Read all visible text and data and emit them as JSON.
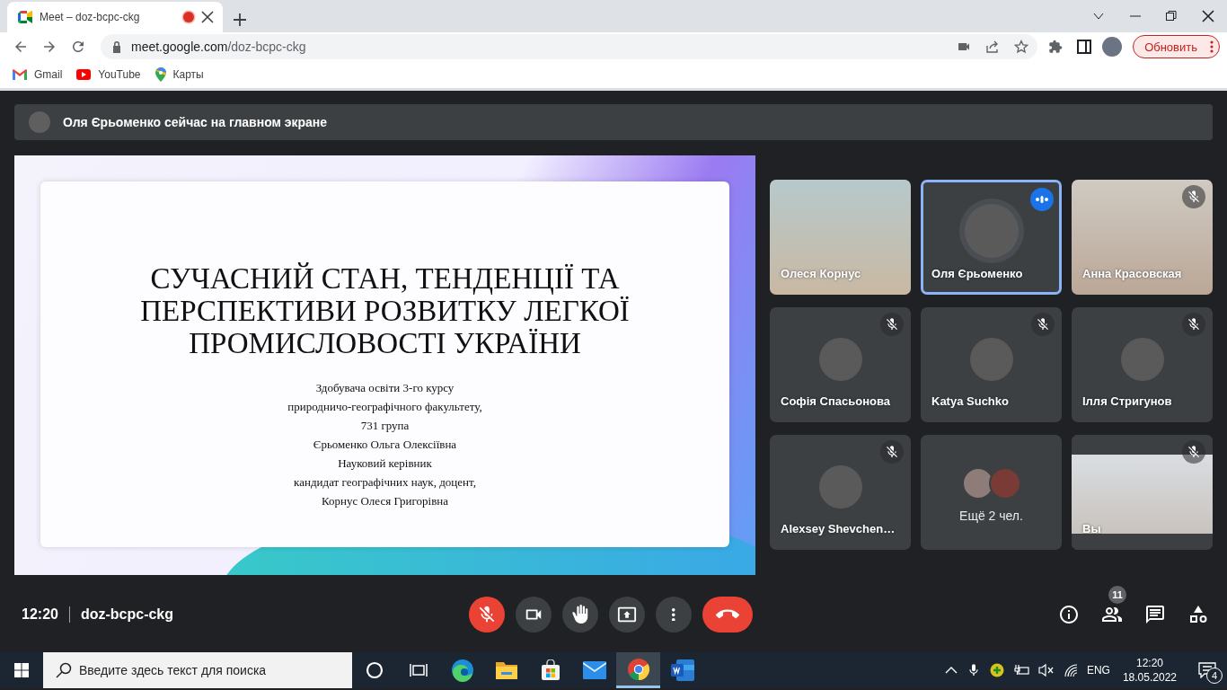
{
  "browser": {
    "tab": {
      "title": "Meet – doz-bcpc-ckg",
      "recording": true
    },
    "url_host": "meet.google.com",
    "url_path": "/doz-bcpc-ckg",
    "update_button": "Обновить",
    "bookmarks": [
      {
        "kind": "gmail",
        "label": "Gmail"
      },
      {
        "kind": "youtube",
        "label": "YouTube"
      },
      {
        "kind": "maps",
        "label": "Карты"
      }
    ]
  },
  "banner": "Оля Єрьоменко сейчас на главном экране",
  "slide": {
    "title_lines": [
      "СУЧАСНИЙ СТАН, ТЕНДЕНЦІЇ ТА",
      "ПЕРСПЕКТИВИ РОЗВИТКУ ЛЕГКОЇ",
      "ПРОМИСЛОВОСТІ УКРАЇНИ"
    ],
    "lines": [
      "Здобувача освіти 3-го курсу",
      "природничо-географічного факультету,",
      "731 група",
      "Єрьоменко Ольга Олексіївна",
      "Науковий керівник",
      "кандидат географічних наук, доцент,",
      "Корнус Олеся Григорівна"
    ]
  },
  "tiles": [
    {
      "kind": "video",
      "name": "Олеся Корнус",
      "muted": false,
      "speaking": false
    },
    {
      "kind": "avatar",
      "name": "Оля Єрьоменко",
      "muted": false,
      "speaking": true
    },
    {
      "kind": "video",
      "name": "Анна Красовская",
      "muted": true,
      "speaking": false
    },
    {
      "kind": "avatar",
      "name": "Софія Спасьонова",
      "muted": true,
      "speaking": false
    },
    {
      "kind": "avatar",
      "name": "Katya Suchko",
      "muted": true,
      "speaking": false
    },
    {
      "kind": "avatar",
      "name": "Ілля Стригунов",
      "muted": true,
      "speaking": false
    },
    {
      "kind": "avatar",
      "name": "Alexsey Shevchen…",
      "muted": true,
      "speaking": false
    },
    {
      "kind": "more",
      "name": "Ещё 2 чел.",
      "muted": false,
      "speaking": false
    },
    {
      "kind": "video",
      "name": "Вы",
      "muted": true,
      "speaking": false
    }
  ],
  "bottom_bar": {
    "time": "12:20",
    "meeting_code": "doz-bcpc-ckg",
    "controls": [
      {
        "kind": "mic",
        "muted": true
      },
      {
        "kind": "camera",
        "muted": false
      },
      {
        "kind": "hand"
      },
      {
        "kind": "present"
      },
      {
        "kind": "more"
      },
      {
        "kind": "end"
      }
    ],
    "side_buttons": [
      {
        "kind": "info"
      },
      {
        "kind": "people",
        "badge": "11"
      },
      {
        "kind": "chat"
      },
      {
        "kind": "activities"
      }
    ]
  },
  "taskbar": {
    "search_placeholder": "Введите здесь текст для поиска",
    "apps": [
      {
        "kind": "cortana",
        "selected": false
      },
      {
        "kind": "taskview",
        "selected": false
      },
      {
        "kind": "edge",
        "selected": false
      },
      {
        "kind": "explorer",
        "selected": false
      },
      {
        "kind": "store",
        "selected": false
      },
      {
        "kind": "mail",
        "selected": false
      },
      {
        "kind": "chrome",
        "selected": true
      },
      {
        "kind": "word",
        "selected": false
      }
    ],
    "language": "ENG",
    "time": "12:20",
    "date": "18.05.2022",
    "notifications": "4"
  }
}
